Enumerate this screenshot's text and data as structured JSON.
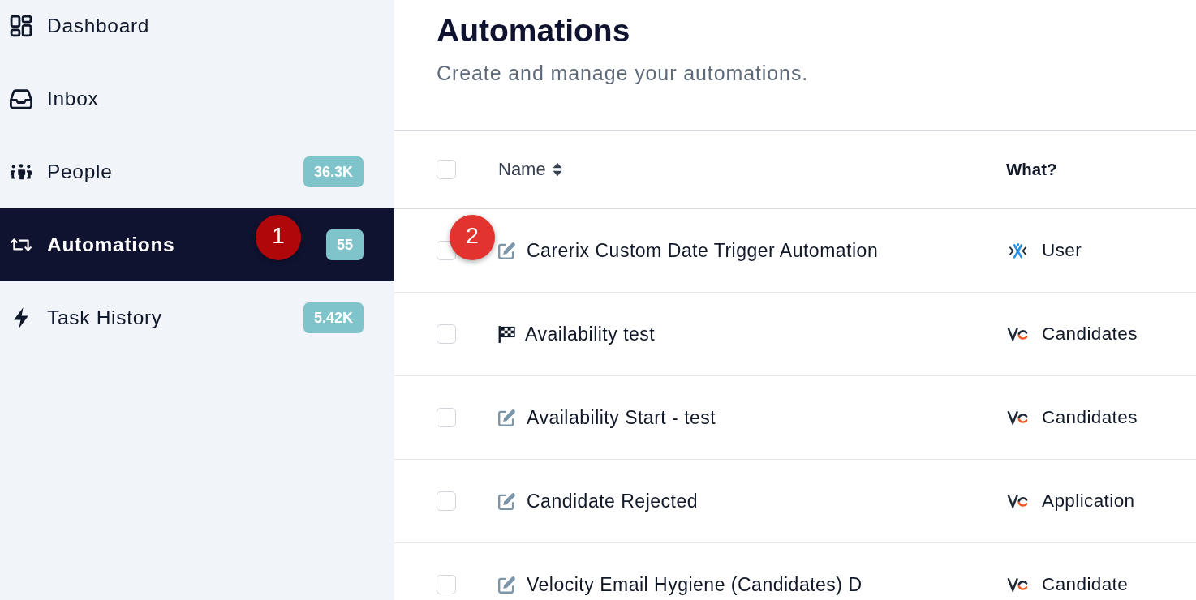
{
  "sidebar": {
    "items": [
      {
        "label": "Dashboard",
        "selected": false
      },
      {
        "label": "Inbox",
        "selected": false
      },
      {
        "label": "People",
        "selected": false,
        "badge": "36.3K"
      },
      {
        "label": "Automations",
        "selected": true,
        "badge": "55"
      },
      {
        "label": "Task History",
        "selected": false,
        "badge": "5.42K"
      }
    ]
  },
  "page": {
    "title": "Automations",
    "subtitle": "Create and manage your automations."
  },
  "table": {
    "select_all": {
      "checked": false
    },
    "columns": [
      {
        "label": "Name",
        "sortable": true
      },
      {
        "label": "What?",
        "sortable": false
      }
    ],
    "rows": [
      {
        "checked": false,
        "kind": "edit",
        "name": "Carerix Custom Date Trigger Automation",
        "what": {
          "kind": "cross",
          "label": "User"
        }
      },
      {
        "checked": false,
        "kind": "flag",
        "name": "Availability test",
        "what": {
          "kind": "vc",
          "label": "Candidates"
        }
      },
      {
        "checked": false,
        "kind": "edit",
        "name": "Availability Start - test",
        "what": {
          "kind": "vc",
          "label": "Candidates"
        }
      },
      {
        "checked": false,
        "kind": "edit",
        "name": "Candidate Rejected",
        "what": {
          "kind": "vc",
          "label": "Application"
        }
      },
      {
        "checked": false,
        "kind": "edit",
        "name": "Velocity Email Hygiene (Candidates) D",
        "what": {
          "kind": "vc",
          "label": "Candidate"
        }
      }
    ]
  },
  "markers": [
    {
      "label": "1",
      "color": "#b0070b"
    },
    {
      "label": "2",
      "color": "#e2332f"
    }
  ]
}
